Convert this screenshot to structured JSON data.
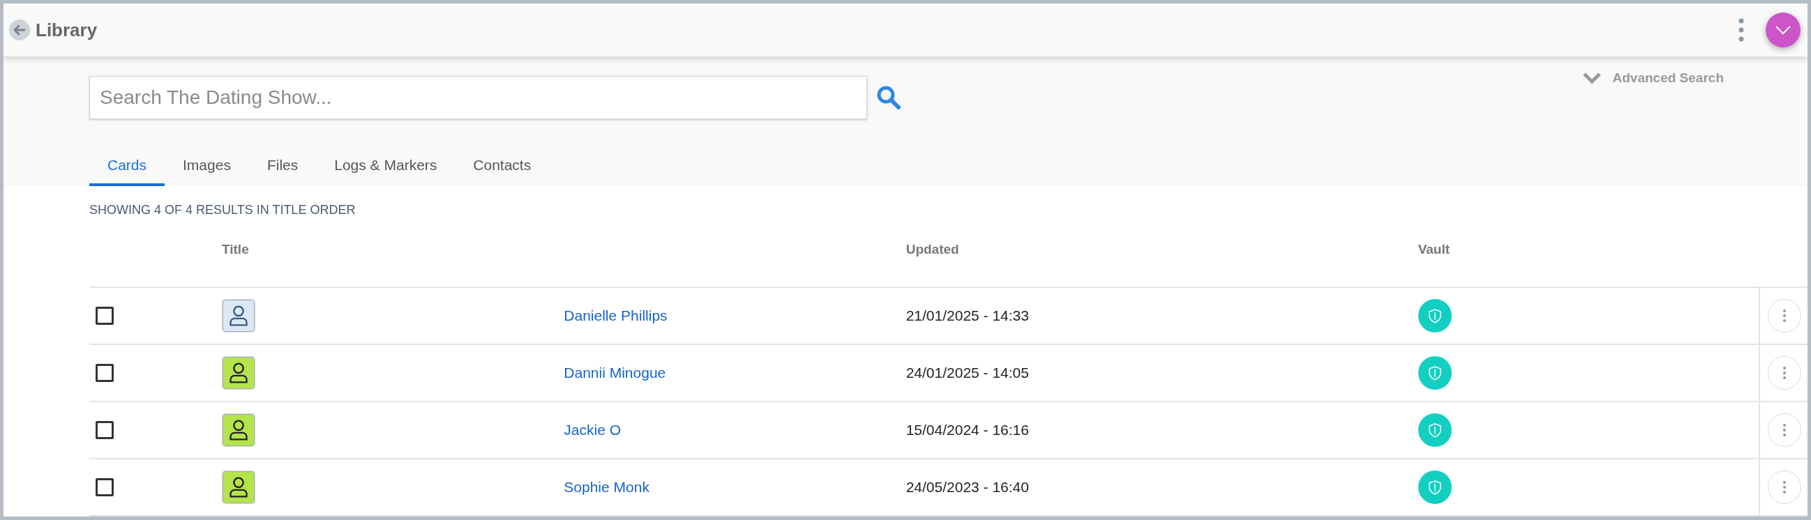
{
  "header": {
    "title": "Library"
  },
  "search": {
    "placeholder": "Search The Dating Show...",
    "advanced_label": "Advanced Search"
  },
  "tabs": [
    {
      "label": "Cards",
      "selected": true
    },
    {
      "label": "Images",
      "selected": false
    },
    {
      "label": "Files",
      "selected": false
    },
    {
      "label": "Logs & Markers",
      "selected": false
    },
    {
      "label": "Contacts",
      "selected": false
    }
  ],
  "results_summary": "SHOWING 4 OF 4 RESULTS IN TITLE ORDER",
  "table": {
    "columns": [
      "Title",
      "Updated",
      "Vault"
    ],
    "rows": [
      {
        "checked": false,
        "color": "#dce8f6",
        "title": "Danielle Phillips",
        "updated": "21/01/2025 - 14:33"
      },
      {
        "checked": false,
        "color": "#b5e34a",
        "title": "Dannii Minogue",
        "updated": "24/01/2025 - 14:05"
      },
      {
        "checked": false,
        "color": "#b5e34a",
        "title": "Jackie O",
        "updated": "15/04/2024 - 16:16"
      },
      {
        "checked": false,
        "color": "#b5e34a",
        "title": "Sophie Monk",
        "updated": "24/05/2023 - 16:40"
      }
    ]
  }
}
